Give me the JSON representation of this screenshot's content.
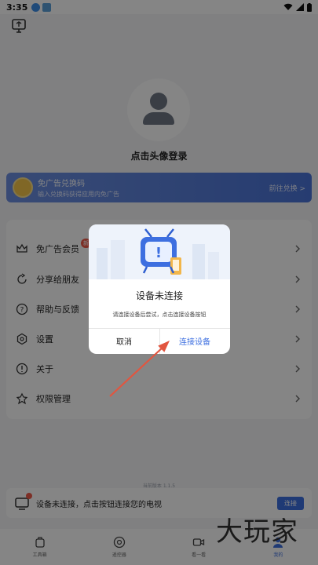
{
  "status_bar": {
    "time": "3:35"
  },
  "profile": {
    "login_text": "点击头像登录"
  },
  "banner": {
    "title": "免广告兑换码",
    "subtitle": "输入兑换码获得应用内免广告",
    "action": "前往兑换 >"
  },
  "menu": {
    "items": [
      {
        "label": "免广告会员",
        "icon": "crown-icon",
        "badge": "新"
      },
      {
        "label": "分享给朋友",
        "icon": "share-icon"
      },
      {
        "label": "帮助与反馈",
        "icon": "help-icon"
      },
      {
        "label": "设置",
        "icon": "settings-icon"
      },
      {
        "label": "关于",
        "icon": "info-icon"
      },
      {
        "label": "权限管理",
        "icon": "permission-icon"
      }
    ]
  },
  "version_text": "当前版本 1.1.5",
  "connect_bar": {
    "text": "设备未连接，点击按钮连接您的电视",
    "button": "连接"
  },
  "tabbar": {
    "tabs": [
      {
        "label": "工具箱",
        "icon": "toolbox-icon"
      },
      {
        "label": "遥控器",
        "icon": "remote-icon"
      },
      {
        "label": "看一看",
        "icon": "video-icon"
      },
      {
        "label": "我的",
        "icon": "profile-icon",
        "active": true
      }
    ]
  },
  "dialog": {
    "title": "设备未连接",
    "message": "请连接设备后尝试，点击连接设备按钮",
    "cancel": "取消",
    "confirm": "连接设备"
  },
  "watermark": "大玩家",
  "colors": {
    "accent": "#3d6fe0",
    "badge": "#f05a4a",
    "arrow": "#e2553f",
    "overlay": "rgba(0,0,0,0.48)"
  }
}
